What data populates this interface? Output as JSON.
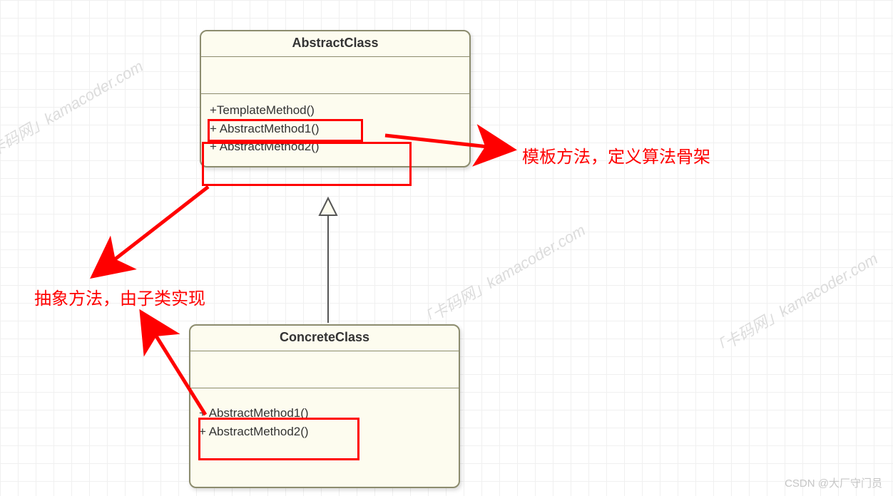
{
  "abstract_class": {
    "title": "AbstractClass",
    "methods": {
      "m1": "+TemplateMethod()",
      "m2": "+ AbstractMethod1()",
      "m3": "+ AbstractMethod2()"
    }
  },
  "concrete_class": {
    "title": "ConcreteClass",
    "methods": {
      "m1": "+ AbstractMethod1()",
      "m2": "+ AbstractMethod2()"
    }
  },
  "annotations": {
    "template_method": "模板方法，定义算法骨架",
    "abstract_method": "抽象方法，由子类实现"
  },
  "watermark": "「卡码网」kamacoder.com",
  "footer": "CSDN @大厂守门员"
}
